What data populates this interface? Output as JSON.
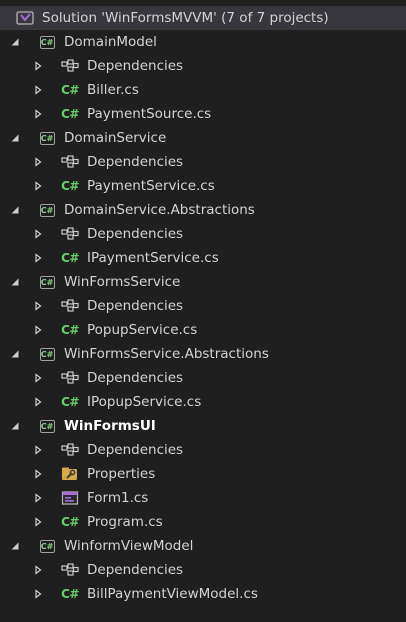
{
  "solution": {
    "label": "Solution 'WinFormsMVVM' (7 of 7 projects)"
  },
  "projects": [
    {
      "name": "DomainModel",
      "items": [
        {
          "type": "dependencies",
          "label": "Dependencies"
        },
        {
          "type": "cs",
          "label": "Biller.cs"
        },
        {
          "type": "cs",
          "label": "PaymentSource.cs"
        }
      ]
    },
    {
      "name": "DomainService",
      "items": [
        {
          "type": "dependencies",
          "label": "Dependencies"
        },
        {
          "type": "cs",
          "label": "PaymentService.cs"
        }
      ]
    },
    {
      "name": "DomainService.Abstractions",
      "items": [
        {
          "type": "dependencies",
          "label": "Dependencies"
        },
        {
          "type": "cs",
          "label": "IPaymentService.cs"
        }
      ]
    },
    {
      "name": "WinFormsService",
      "items": [
        {
          "type": "dependencies",
          "label": "Dependencies"
        },
        {
          "type": "cs",
          "label": "PopupService.cs"
        }
      ]
    },
    {
      "name": "WinFormsService.Abstractions",
      "items": [
        {
          "type": "dependencies",
          "label": "Dependencies"
        },
        {
          "type": "cs",
          "label": "IPopupService.cs"
        }
      ]
    },
    {
      "name": "WinFormsUI",
      "bold": true,
      "items": [
        {
          "type": "dependencies",
          "label": "Dependencies"
        },
        {
          "type": "properties",
          "label": "Properties"
        },
        {
          "type": "form",
          "label": "Form1.cs"
        },
        {
          "type": "cs",
          "label": "Program.cs"
        }
      ]
    },
    {
      "name": "WinformViewModel",
      "items": [
        {
          "type": "dependencies",
          "label": "Dependencies"
        },
        {
          "type": "cs",
          "label": "BillPaymentViewModel.cs"
        }
      ]
    }
  ],
  "colors": {
    "background": "#1f1f1f",
    "selected": "#37373d",
    "cs_green": "#6ccf6c",
    "vs_purple": "#a66bd6"
  }
}
